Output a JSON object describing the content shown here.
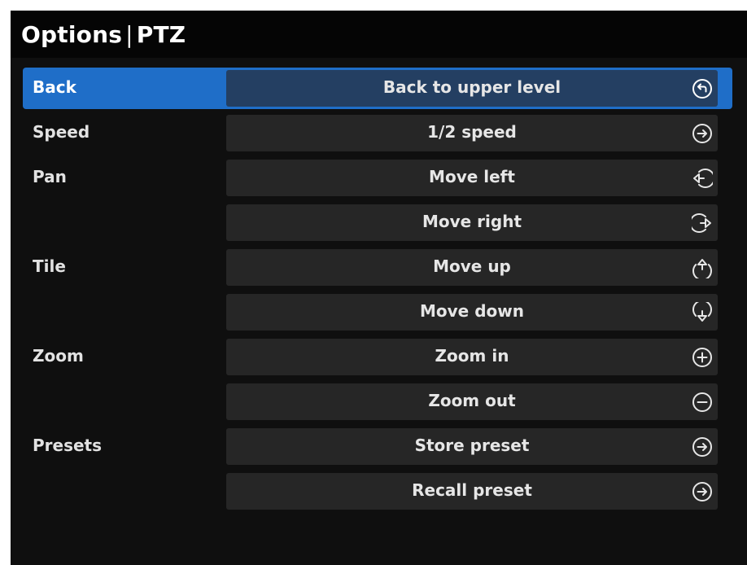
{
  "header": {
    "title_left": "Options",
    "separator": "|",
    "title_right": "PTZ"
  },
  "menu": {
    "rows": [
      {
        "label": "Back",
        "action": "Back to upper level",
        "icon": "back-circle-icon",
        "selected": true
      },
      {
        "label": "Speed",
        "action": "1/2 speed",
        "icon": "arrow-right-circle-icon",
        "selected": false
      },
      {
        "label": "Pan",
        "action": "Move left",
        "icon": "move-left-icon",
        "selected": false
      },
      {
        "label": "",
        "action": "Move right",
        "icon": "move-right-icon",
        "selected": false
      },
      {
        "label": "Tile",
        "action": "Move up",
        "icon": "move-up-icon",
        "selected": false
      },
      {
        "label": "",
        "action": "Move down",
        "icon": "move-down-icon",
        "selected": false
      },
      {
        "label": "Zoom",
        "action": "Zoom in",
        "icon": "zoom-in-icon",
        "selected": false
      },
      {
        "label": "",
        "action": "Zoom out",
        "icon": "zoom-out-icon",
        "selected": false
      },
      {
        "label": "Presets",
        "action": "Store preset",
        "icon": "arrow-right-circle-icon",
        "selected": false
      },
      {
        "label": "",
        "action": "Recall preset",
        "icon": "arrow-right-circle-icon",
        "selected": false
      }
    ]
  },
  "colors": {
    "background": "#0f0f0f",
    "titlebar": "#050505",
    "selected_row": "#1f6ec8",
    "selected_action": "#243f62",
    "action_button": "#262626",
    "text": "#e6e6e6"
  }
}
